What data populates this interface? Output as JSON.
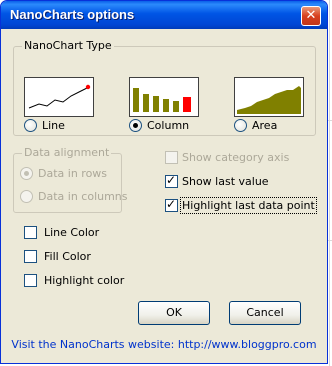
{
  "window": {
    "title": "NanoCharts options",
    "close_glyph": "✕"
  },
  "chart_type": {
    "label": "NanoChart Type",
    "options": [
      {
        "label": "Line",
        "selected": false
      },
      {
        "label": "Column",
        "selected": true
      },
      {
        "label": "Area",
        "selected": false
      }
    ]
  },
  "data_alignment": {
    "label": "Data alignment",
    "options": [
      {
        "label": "Data in rows",
        "selected": true
      },
      {
        "label": "Data in columns",
        "selected": false
      }
    ]
  },
  "options": {
    "show_category_axis": {
      "label": "Show category axis",
      "checked": false,
      "enabled": false
    },
    "show_last_value": {
      "label": "Show last value",
      "checked": true,
      "enabled": true
    },
    "highlight_last_point": {
      "label": "Highlight last data point",
      "checked": true,
      "enabled": true
    }
  },
  "colors": {
    "line_color": "Line Color",
    "fill_color": "Fill Color",
    "highlight_color": "Highlight color"
  },
  "buttons": {
    "ok": "OK",
    "cancel": "Cancel"
  },
  "footer_link": "Visit the NanoCharts website: http://www.bloggpro.com",
  "palette": {
    "accent": "#0055e5",
    "column_fill": "#808000",
    "highlight": "#ff0000"
  }
}
